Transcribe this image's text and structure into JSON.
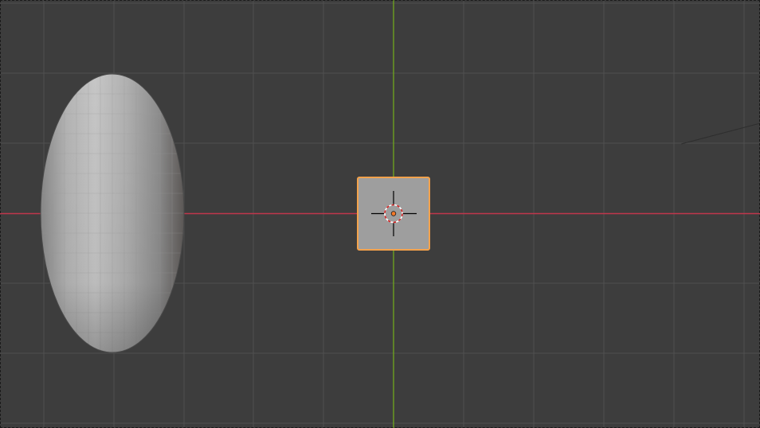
{
  "viewport": {
    "view": "3d-viewport",
    "background_color": "#3d3d3d",
    "grid_color": "#505050",
    "x_axis_color": "#c0364c",
    "y_axis_color": "#6a9a22",
    "selection_outline_color": "#f4a24c",
    "origin_color": "#f47a2a"
  },
  "objects": [
    {
      "name": "ellipsoid",
      "shape": "uv-sphere-stretched",
      "selected": false
    },
    {
      "name": "cube",
      "shape": "cube",
      "selected": true
    }
  ],
  "cursor": {
    "name": "3d-cursor",
    "icon": "crosshair-icon"
  }
}
